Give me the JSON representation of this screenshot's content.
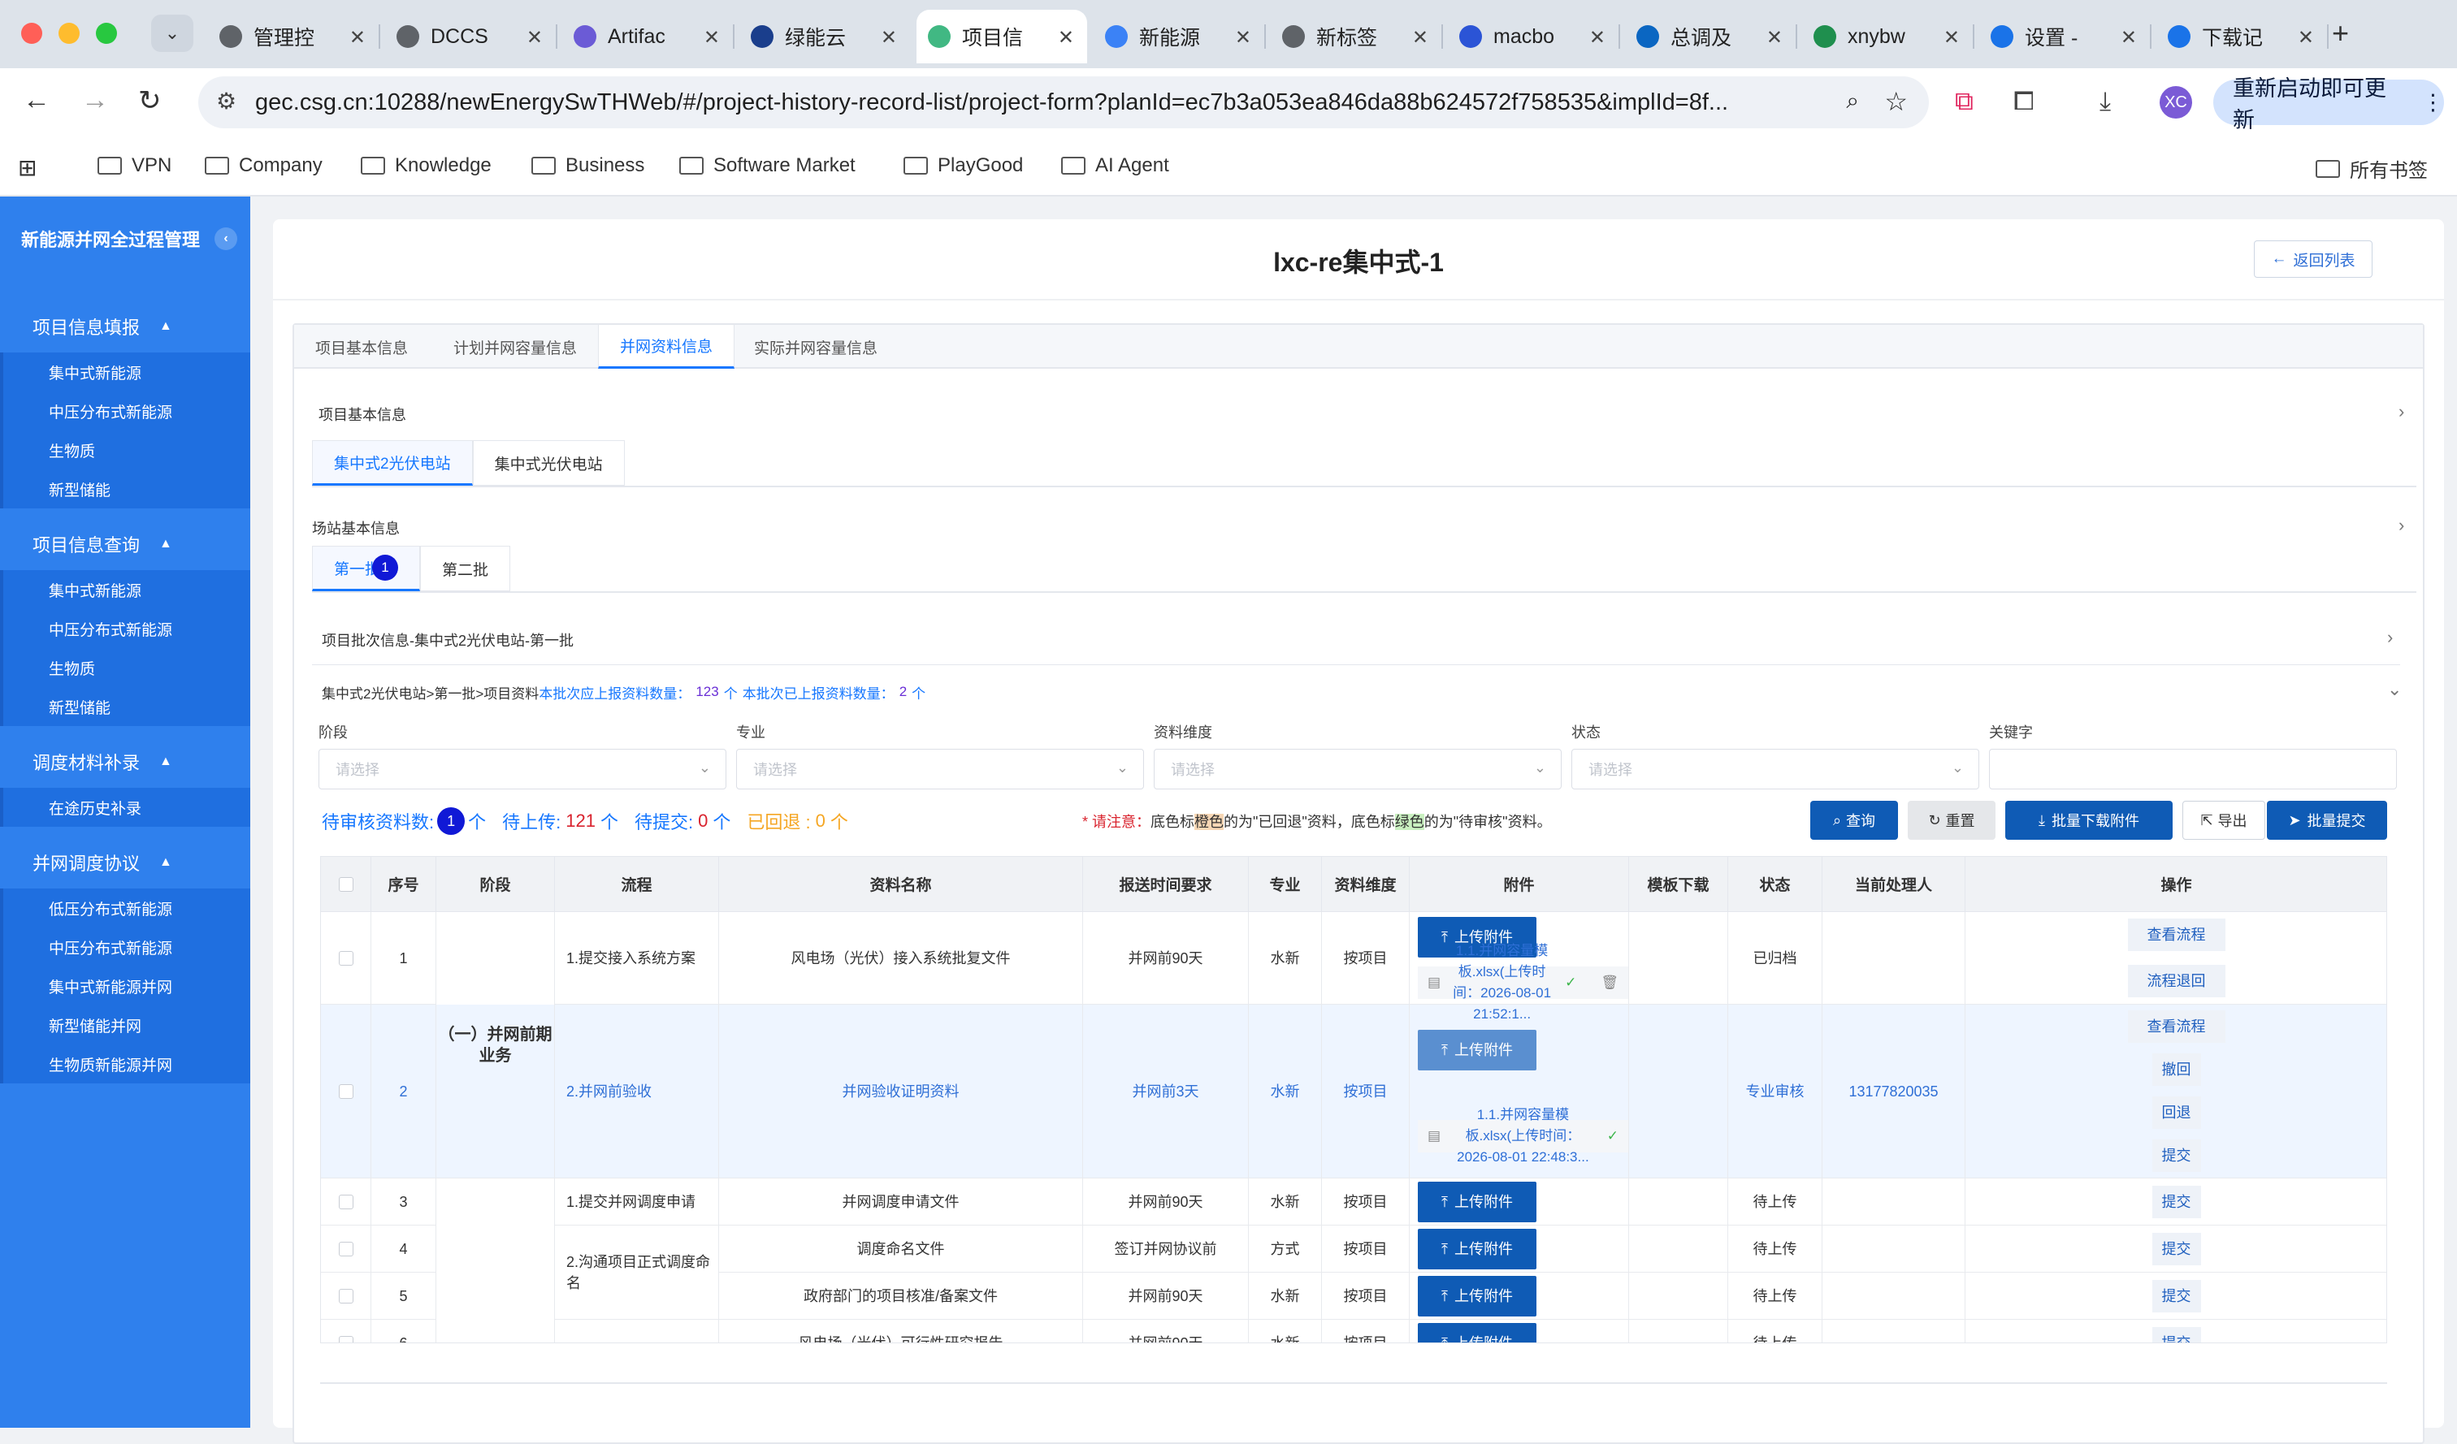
{
  "browser": {
    "tabs": [
      {
        "title": "管理控",
        "icon": "globe-icon",
        "color": "#5f6368"
      },
      {
        "title": "DCCS",
        "icon": "globe-icon",
        "color": "#5f6368"
      },
      {
        "title": "Artifac",
        "icon": "artifact-icon",
        "color": "#6b5bd6"
      },
      {
        "title": "绿能云",
        "icon": "cloud-icon",
        "color": "#1a3e8c"
      },
      {
        "title": "项目信",
        "icon": "vue-icon",
        "color": "#41b883"
      },
      {
        "title": "新能源",
        "icon": "site-icon",
        "color": "#3b82f6"
      },
      {
        "title": "新标签",
        "icon": "globe-icon",
        "color": "#5f6368"
      },
      {
        "title": "macbo",
        "icon": "paw-icon",
        "color": "#2b54d6"
      },
      {
        "title": "总调及",
        "icon": "outlook-icon",
        "color": "#0a66c2"
      },
      {
        "title": "xnybw",
        "icon": "sheet-icon",
        "color": "#1f8f4e"
      },
      {
        "title": "设置 -",
        "icon": "gear-icon",
        "color": "#1a73e8"
      },
      {
        "title": "下载记",
        "icon": "download-icon",
        "color": "#1a73e8"
      }
    ],
    "url": "gec.csg.cn:10288/newEnergySwTHWeb/#/project-history-record-list/project-form?planId=ec7b3a053ea846da88b624572f758535&implId=8f...",
    "profile_initials": "XC",
    "update_label": "重新启动即可更新",
    "bookmarks": [
      "VPN",
      "Company",
      "Knowledge",
      "Business",
      "Software Market",
      "PlayGood",
      "AI Agent"
    ],
    "all_bookmarks": "所有书签"
  },
  "sidebar": {
    "title": "新能源并网全过程管理",
    "groups": [
      {
        "label": "项目信息填报",
        "items": [
          "集中式新能源",
          "中压分布式新能源",
          "生物质",
          "新型储能"
        ]
      },
      {
        "label": "项目信息查询",
        "items": [
          "集中式新能源",
          "中压分布式新能源",
          "生物质",
          "新型储能"
        ]
      },
      {
        "label": "调度材料补录",
        "items": [
          "在途历史补录"
        ]
      },
      {
        "label": "并网调度协议",
        "items": [
          "低压分布式新能源",
          "中压分布式新能源",
          "集中式新能源并网",
          "新型储能并网",
          "生物质新能源并网"
        ]
      }
    ]
  },
  "page": {
    "title": "lxc-re集中式-1",
    "back_label": "返回列表",
    "tabs": [
      "项目基本信息",
      "计划并网容量信息",
      "并网资料信息",
      "实际并网容量信息"
    ],
    "section_basic": "项目基本信息",
    "station_tabs": [
      "集中式2光伏电站",
      "集中式光伏电站"
    ],
    "section_station": "场站基本信息",
    "batch_tabs": [
      "第一批",
      "第二批"
    ],
    "batch_badge": "1",
    "section_batch": "项目批次信息-集中式2光伏电站-第一批",
    "breadcrumb_prefix": "集中式2光伏电站>第一批>项目资料",
    "breadcrumb_required_label": "本批次应上报资料数量：",
    "breadcrumb_required_value": "123",
    "breadcrumb_unit1": "个",
    "breadcrumb_reported_label": "本批次已上报资料数量：",
    "breadcrumb_reported_value": "2",
    "breadcrumb_unit2": "个"
  },
  "filters": [
    {
      "label": "阶段",
      "placeholder": "请选择"
    },
    {
      "label": "专业",
      "placeholder": "请选择"
    },
    {
      "label": "资料维度",
      "placeholder": "请选择"
    },
    {
      "label": "状态",
      "placeholder": "请选择"
    },
    {
      "label": "关键字",
      "placeholder": ""
    }
  ],
  "counts": {
    "pending_review_label": "待审核资料数:",
    "pending_review_value": "1",
    "pending_review_unit": "个",
    "to_upload_label": "待上传:",
    "to_upload_value": "121",
    "to_upload_unit": "个",
    "to_submit_label": "待提交:",
    "to_submit_value": "0",
    "to_submit_unit": "个",
    "returned_label": "已回退 :",
    "returned_value": "0",
    "returned_unit": "个"
  },
  "notice": {
    "prefix": "* 请注意：",
    "text1": "底色标",
    "orange": "橙色",
    "text2": "的为\"已回退\"资料，底色标",
    "green": "绿色",
    "text3": "的为\"待审核\"资料。"
  },
  "actions": {
    "query": "查询",
    "reset": "重置",
    "batch_download": "批量下载附件",
    "export": "导出",
    "batch_submit": "批量提交"
  },
  "table": {
    "headers": [
      "序号",
      "阶段",
      "流程",
      "资料名称",
      "报送时间要求",
      "专业",
      "资料维度",
      "附件",
      "模板下载",
      "状态",
      "当前处理人",
      "操作"
    ],
    "stage_group": "（一）并网前期业务",
    "upload_label": "上传附件",
    "rows": [
      {
        "no": "1",
        "flow": "1.提交接入系统方案",
        "name": "风电场（光伏）接入系统批复文件",
        "time": "并网前90天",
        "major": "水新",
        "dim": "按项目",
        "file": "1.1.并网容量模板.xlsx(上传时间：2026-08-01 21:52:1...",
        "status": "已归档",
        "handler": "",
        "ops": [
          "查看流程",
          "流程退回"
        ]
      },
      {
        "no": "2",
        "flow": "2.并网前验收",
        "name": "并网验收证明资料",
        "time": "并网前3天",
        "major": "水新",
        "dim": "按项目",
        "file": "1.1.并网容量模板.xlsx(上传时间：2026-08-01 22:48:3...",
        "status": "专业审核",
        "handler": "13177820035",
        "ops": [
          "查看流程",
          "撤回",
          "回退",
          "提交"
        ]
      },
      {
        "no": "3",
        "flow": "1.提交并网调度申请",
        "name": "并网调度申请文件",
        "time": "并网前90天",
        "major": "水新",
        "dim": "按项目",
        "status": "待上传",
        "ops": [
          "提交"
        ]
      },
      {
        "no": "4",
        "flow": "2.沟通项目正式调度命名",
        "name": "调度命名文件",
        "time": "签订并网协议前",
        "major": "方式",
        "dim": "按项目",
        "status": "待上传",
        "ops": [
          "提交"
        ]
      },
      {
        "no": "5",
        "flow": "",
        "name": "政府部门的项目核准/备案文件",
        "time": "并网前90天",
        "major": "水新",
        "dim": "按项目",
        "status": "待上传",
        "ops": [
          "提交"
        ]
      },
      {
        "no": "6",
        "flow": "",
        "name": "风电场（光伏）可行性研究报告",
        "time": "并网前90天",
        "major": "水新",
        "dim": "按项目",
        "status": "待上传",
        "ops": [
          "提交"
        ]
      }
    ]
  },
  "colors": {
    "sidebar": "#2f80ed",
    "primary": "#0f5bb5",
    "badge": "#1019d6",
    "link": "#1677ff"
  }
}
